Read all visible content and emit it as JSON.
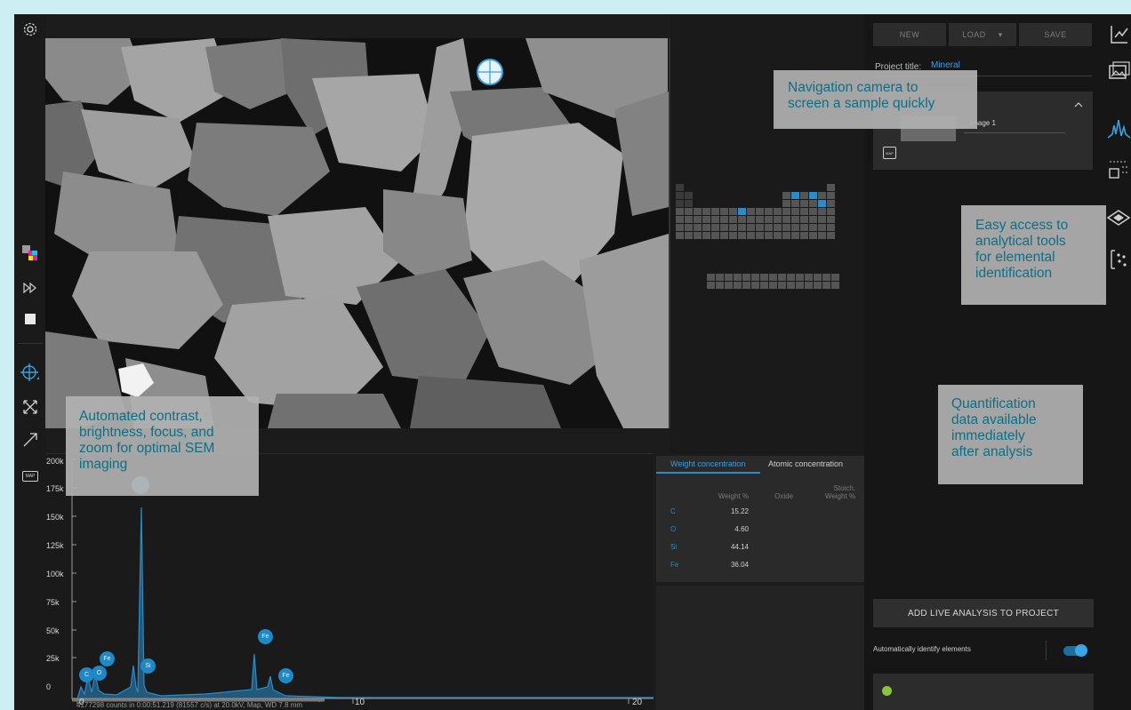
{
  "left_toolbar": {
    "icons": [
      "gear-icon",
      "color-palette-icon",
      "fast-forward-icon",
      "stop-icon",
      "crosshair-icon",
      "fit-arrows-icon",
      "arrow-icon",
      "map-icon"
    ],
    "map_label": "MAP"
  },
  "periodic_table": {
    "selected_colors": "#2a8cc8",
    "cell_color": "#555555"
  },
  "spectrum": {
    "y_ticks": [
      "200k",
      "175k",
      "150k",
      "125k",
      "100k",
      "75k",
      "50k",
      "25k",
      "0"
    ],
    "x_ticks": [
      "0",
      "10",
      "20"
    ],
    "peaks": [
      {
        "label": "C"
      },
      {
        "label": "Fe"
      },
      {
        "label": "O"
      },
      {
        "label": "Si"
      },
      {
        "label": "Fe"
      },
      {
        "label": "Fe"
      }
    ],
    "footer": "4177298 counts in 0:00:51.219 (81557 c/s) at 20.0kV, Map, WD 7.8 mm",
    "line_color": "#2a8cc8"
  },
  "quant": {
    "tabs": [
      "Weight concentration",
      "Atomic concentration"
    ],
    "headers": {
      "weight": "Weight %",
      "oxide": "Oxide",
      "stoich_line1": "Stoich.",
      "stoich_line2": "Weight %"
    },
    "rows": [
      {
        "element": "C",
        "weight": "15.22"
      },
      {
        "element": "O",
        "weight": "4.60"
      },
      {
        "element": "Si",
        "weight": "44.14"
      },
      {
        "element": "Fe",
        "weight": "36.04"
      }
    ]
  },
  "project": {
    "buttons": {
      "new": "NEW",
      "load": "LOAD",
      "save": "SAVE"
    },
    "title_label": "Project title:",
    "title_value": "Mineral",
    "card_name": "Image 1",
    "map_label": "MAP"
  },
  "actions": {
    "add_live": "ADD LIVE ANALYSIS TO PROJECT",
    "auto_identify": "Automatically identify elements",
    "auto_identify_on": true
  },
  "right_icons": [
    "chart-export-icon",
    "image-gallery-icon",
    "spectrum-icon",
    "line-scan-icon",
    "layers-icon",
    "element-map-icon"
  ],
  "callouts": {
    "navigation": [
      "Navigation camera to",
      "screen a sample quickly"
    ],
    "tools": [
      "Easy access to",
      "analytical tools",
      "for elemental",
      "identification"
    ],
    "quant": [
      "Quantification",
      "data available",
      "immediately",
      "after analysis"
    ],
    "contrast": [
      "Automated contrast,",
      "brightness, focus, and",
      "zoom for optimal SEM",
      "imaging"
    ]
  }
}
